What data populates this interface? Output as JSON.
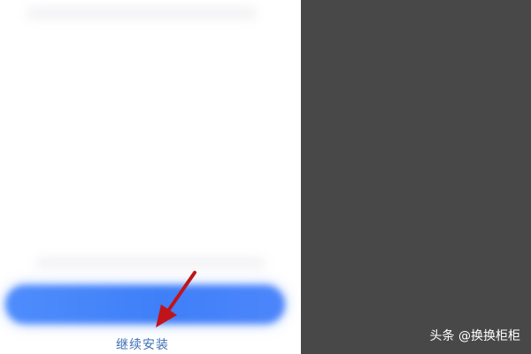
{
  "install": {
    "continue_label": "继续安装"
  },
  "watermark": {
    "text": "头条 @换换柜柜"
  },
  "colors": {
    "button_blue": "#3f7ff8",
    "link_blue": "#3e6fb5",
    "arrow_red": "#c0141b",
    "dark_panel": "#484848"
  }
}
